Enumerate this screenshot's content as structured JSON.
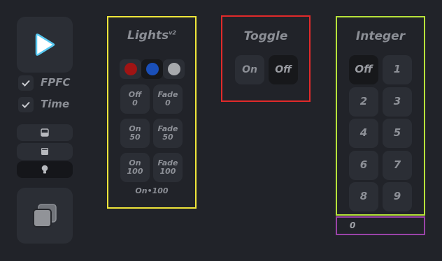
{
  "sidebar": {
    "fpfc_label": "FPFC",
    "time_label": "Time",
    "fpfc_checked": true,
    "time_checked": true,
    "play_icon": "play-icon",
    "copy_icon": "copy-icon"
  },
  "lights": {
    "title": "Lights",
    "version": "v2",
    "colors": [
      "#a01414",
      "#1a4fb8",
      "#a7a9ad"
    ],
    "buttons": [
      {
        "label": "Off\n0"
      },
      {
        "label": "Fade\n0"
      },
      {
        "label": "On\n50"
      },
      {
        "label": "Fade\n50"
      },
      {
        "label": "On\n100"
      },
      {
        "label": "Fade\n100"
      }
    ],
    "status": "On•100"
  },
  "toggle": {
    "title": "Toggle",
    "on_label": "On",
    "off_label": "Off",
    "selected": "Off"
  },
  "integer": {
    "title": "Integer",
    "keys": [
      "Off",
      "1",
      "2",
      "3",
      "4",
      "5",
      "6",
      "7",
      "8",
      "9"
    ],
    "selected": "Off",
    "value": "0"
  },
  "colors": {
    "background": "#212329",
    "button": "#2b2e35",
    "button_selected": "#17181b",
    "frame_lights": "#efe63a",
    "frame_toggle": "#e12a2a",
    "frame_integer": "#b7e23a",
    "frame_value": "#9a43a8",
    "play_accent": "#58c8f0"
  }
}
